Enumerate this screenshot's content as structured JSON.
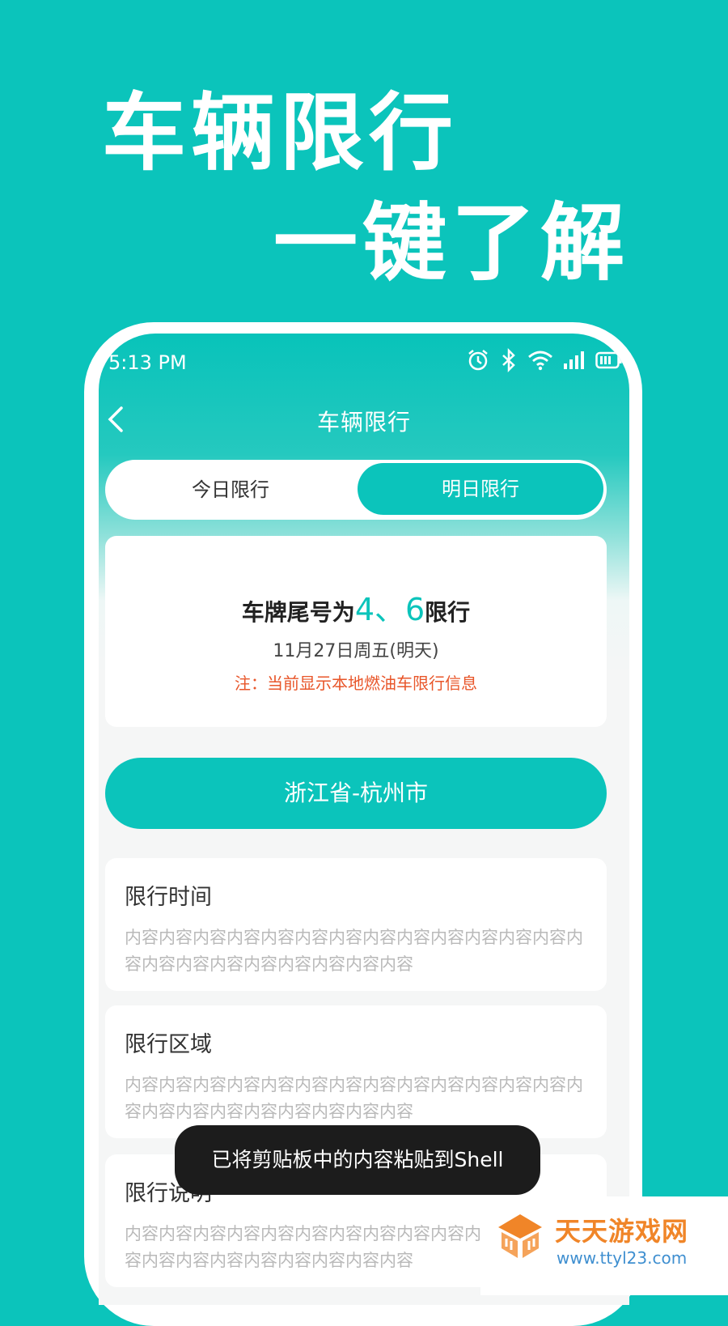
{
  "promo": {
    "headline_line1": "车辆限行",
    "headline_line2": "一键了解"
  },
  "status_bar": {
    "time": "5:13 PM",
    "icons": [
      "alarm-icon",
      "bluetooth-icon",
      "wifi-icon",
      "signal-icon",
      "battery-icon"
    ]
  },
  "nav": {
    "title": "车辆限行",
    "back_icon": "chevron-left-icon"
  },
  "tabs": [
    {
      "label": "今日限行",
      "selected": false
    },
    {
      "label": "明日限行",
      "selected": true
    }
  ],
  "restriction": {
    "prefix": "车牌尾号为",
    "numbers": "4、6",
    "suffix": "限行",
    "date": "11月27日周五(明天)",
    "note": "注：当前显示本地燃油车限行信息"
  },
  "city_button": "浙江省-杭州市",
  "sections": [
    {
      "title": "限行时间",
      "content": "内容内容内容内容内容内容内容内容内容内容内容内容内容内容内容内容内容内容内容内容内容内容"
    },
    {
      "title": "限行区域",
      "content": "内容内容内容内容内容内容内容内容内容内容内容内容内容内容内容内容内容内容内容内容内容内容"
    },
    {
      "title": "限行说明",
      "content": "内容内容内容内容内容内容内容内容内容内容内容内容内容内容内容内容内容内容内容内容内容内容"
    }
  ],
  "toast": "已将剪贴板中的内容粘贴到Shell",
  "watermark": {
    "title": "天天游戏网",
    "url": "www.ttyl23.com"
  },
  "colors": {
    "brand": "#0bc4bb",
    "warning": "#e8562a",
    "watermark_orange": "#f08528",
    "watermark_blue": "#3f8fd0"
  }
}
